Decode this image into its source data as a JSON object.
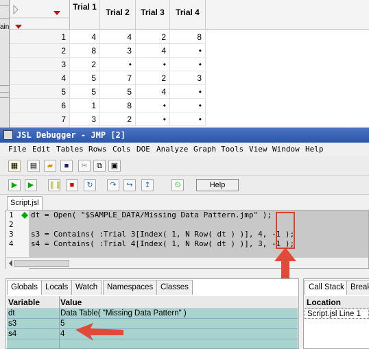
{
  "table": {
    "columns": [
      "Trial 1",
      "Trial 2",
      "Trial 3",
      "Trial 4"
    ],
    "rows": [
      [
        "1",
        "4",
        "4",
        "2",
        "8"
      ],
      [
        "2",
        "8",
        "3",
        "4",
        "•"
      ],
      [
        "3",
        "2",
        "•",
        "•",
        "•"
      ],
      [
        "4",
        "5",
        "7",
        "2",
        "3"
      ],
      [
        "5",
        "5",
        "5",
        "4",
        "•"
      ],
      [
        "6",
        "1",
        "8",
        "•",
        "•"
      ],
      [
        "7",
        "3",
        "2",
        "•",
        "•"
      ]
    ],
    "side_cut": "ain"
  },
  "debugger": {
    "title": "JSL Debugger - JMP [2]",
    "menu": [
      "File",
      "Edit",
      "Tables",
      "Rows",
      "Cols",
      "DOE",
      "Analyze",
      "Graph",
      "Tools",
      "View",
      "Window",
      "Help"
    ],
    "help_button": "Help",
    "script_tab": "Script.jsl",
    "lines": [
      {
        "num": "1",
        "text": "dt = Open( \"$SAMPLE_DATA/Missing Data Pattern.jmp\" );"
      },
      {
        "num": "2",
        "text": ""
      },
      {
        "num": "3",
        "text": "s3 = Contains( :Trial 3[Index( 1, N Row( dt ) )], 4, -1 );"
      },
      {
        "num": "4",
        "text": "s4 = Contains( :Trial 4[Index( 1, N Row( dt ) )], 3, -1 );"
      }
    ],
    "var_tabs": [
      "Globals",
      "Locals",
      "Watch",
      "Namespaces",
      "Classes"
    ],
    "var_headers": {
      "variable": "Variable",
      "value": "Value"
    },
    "variables": [
      {
        "name": "dt",
        "value": "Data Table( \"Missing Data Pattern\" )"
      },
      {
        "name": "s3",
        "value": "5"
      },
      {
        "name": "s4",
        "value": "4"
      }
    ],
    "stack_tabs": [
      "Call Stack",
      "Break"
    ],
    "stack_header": "Location",
    "stack_rows": [
      "Script.jsl Line 1"
    ]
  },
  "colors": {
    "accent": "#e04a3a",
    "title_bar": "#3a64b8",
    "highlight": "#a9d3cf"
  }
}
